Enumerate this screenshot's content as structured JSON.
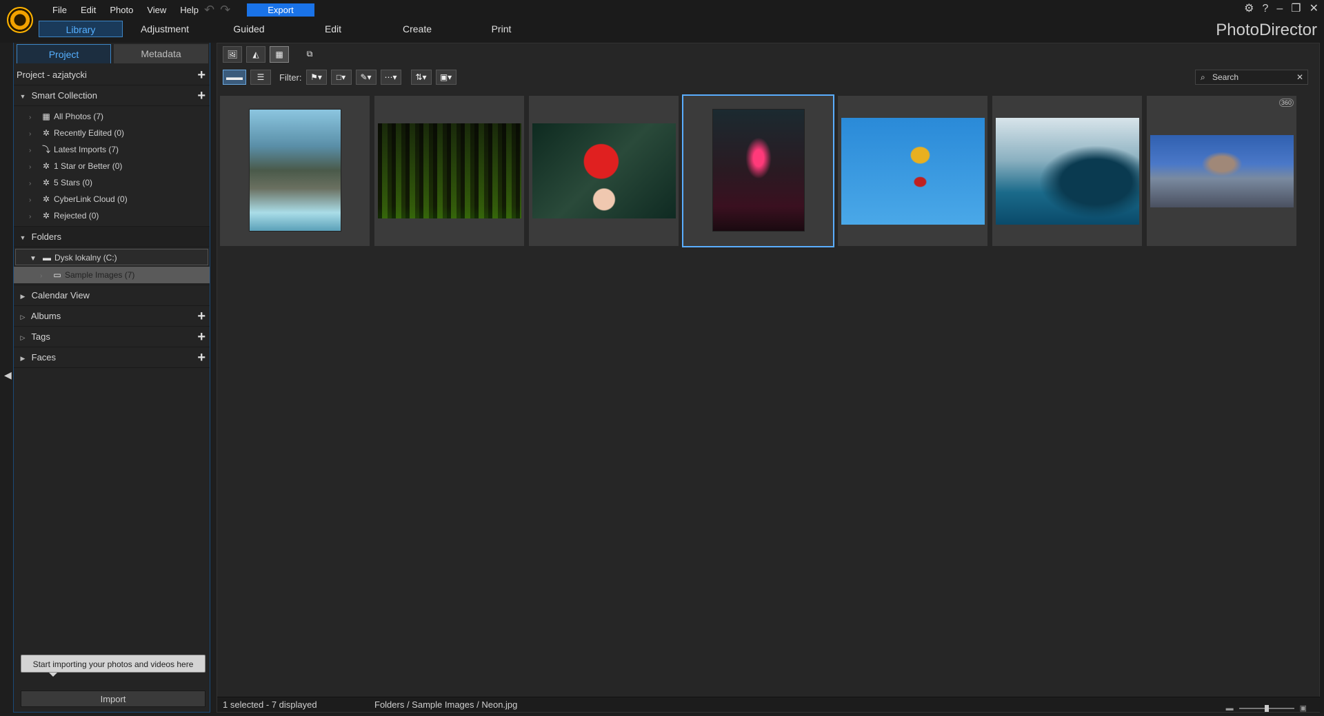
{
  "menu": [
    "File",
    "Edit",
    "Photo",
    "View",
    "Help"
  ],
  "export_label": "Export",
  "app_name": "PhotoDirector",
  "modes": [
    "Library",
    "Adjustment",
    "Guided",
    "Edit",
    "Create",
    "Print"
  ],
  "active_mode": "Library",
  "panel_tabs": [
    "Project",
    "Metadata"
  ],
  "project_label": "Project - azjatycki",
  "smart_collection": {
    "label": "Smart Collection",
    "items": [
      "All Photos (7)",
      "Recently Edited (0)",
      "Latest Imports (7)",
      "1 Star or Better (0)",
      "5 Stars (0)",
      "CyberLink Cloud (0)",
      "Rejected (0)"
    ]
  },
  "folders": {
    "label": "Folders",
    "drive": "Dysk lokalny (C:)",
    "folder": "Sample Images (7)"
  },
  "sections": [
    "Calendar View",
    "Albums",
    "Tags",
    "Faces"
  ],
  "tooltip": "Start importing your photos and videos here",
  "import_label": "Import",
  "filter_label": "Filter:",
  "search_placeholder": "Search",
  "thumb_badge": "360",
  "status": {
    "selection": "1 selected - 7 displayed",
    "path": "Folders / Sample Images / Neon.jpg"
  },
  "photos": [
    {
      "name": "limestone-rock-boat"
    },
    {
      "name": "forest-sunlight"
    },
    {
      "name": "red-maple-leaf"
    },
    {
      "name": "neon-crepe-cafe"
    },
    {
      "name": "skateboarder-jump"
    },
    {
      "name": "ocean-wave"
    },
    {
      "name": "panorama-360"
    }
  ],
  "colors": {
    "accent": "#1a73e8",
    "selected_border": "#5aaeff"
  }
}
